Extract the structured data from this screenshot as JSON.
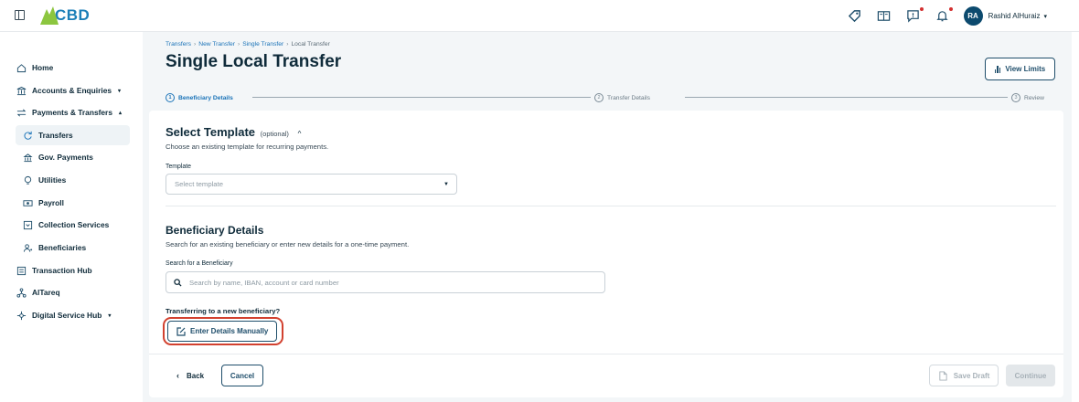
{
  "brand": {
    "name": "CBD",
    "logo_color": "#8cc63f",
    "text_color": "#1c7fb8"
  },
  "topbar": {
    "icons": [
      "tag-icon",
      "book-icon",
      "message-icon",
      "bell-icon"
    ],
    "user_initials": "RA",
    "user_name": "Rashid AlHuraiz"
  },
  "sidebar": {
    "items": [
      {
        "label": "Home",
        "icon": "home-icon"
      },
      {
        "label": "Accounts & Enquiries",
        "icon": "bank-icon",
        "expand": "▾"
      },
      {
        "label": "Payments & Transfers",
        "icon": "transfer-icon",
        "expand": "▴"
      },
      {
        "label": "Transfers",
        "icon": "cycle-icon",
        "active": true
      },
      {
        "label": "Gov. Payments",
        "icon": "government-icon"
      },
      {
        "label": "Utilities",
        "icon": "bulb-icon"
      },
      {
        "label": "Payroll",
        "icon": "cash-icon"
      },
      {
        "label": "Collection Services",
        "icon": "inbox-icon"
      },
      {
        "label": "Beneficiaries",
        "icon": "users-icon"
      },
      {
        "label": "Transaction Hub",
        "icon": "list-icon"
      },
      {
        "label": "AlTareq",
        "icon": "network-icon"
      },
      {
        "label": "Digital Service Hub",
        "icon": "hub-icon",
        "expand": "▾"
      }
    ]
  },
  "breadcrumb": {
    "items": [
      "Transfers",
      "New Transfer",
      "Single Transfer"
    ],
    "current": "Local Transfer",
    "separator": "›"
  },
  "page": {
    "title": "Single Local Transfer",
    "view_limits_label": "View Limits"
  },
  "stepper": {
    "steps": [
      {
        "num": "1",
        "label": "Beneficiary Details",
        "state": "active"
      },
      {
        "num": "2",
        "label": "Transfer Details",
        "state": "pending"
      },
      {
        "num": "3",
        "label": "Review",
        "state": "pending"
      }
    ]
  },
  "template_section": {
    "title": "Select Template",
    "optional": "(optional)",
    "chevron": "^",
    "description": "Choose an existing template for recurring payments.",
    "field_label": "Template",
    "placeholder": "Select template"
  },
  "beneficiary_section": {
    "title": "Beneficiary Details",
    "description": "Search for an existing beneficiary or enter new details for a one-time payment.",
    "search_label": "Search for a Beneficiary",
    "search_placeholder": "Search by name, IBAN, account or card number",
    "new_prompt": "Transferring to a new beneficiary?",
    "manual_button": "Enter Details Manually"
  },
  "footer": {
    "back": "Back",
    "cancel": "Cancel",
    "save_draft": "Save Draft",
    "continue": "Continue"
  },
  "colors": {
    "primary": "#1f4e6b",
    "link": "#1a73b8",
    "highlight": "#d2412f",
    "page_bg": "#f3f6f8"
  }
}
